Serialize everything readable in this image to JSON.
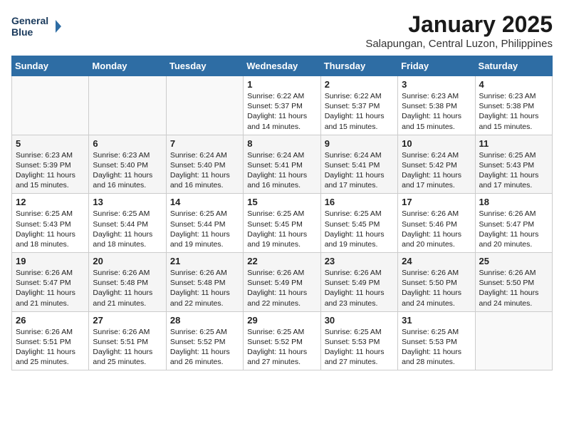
{
  "header": {
    "logo_line1": "General",
    "logo_line2": "Blue",
    "month": "January 2025",
    "location": "Salapungan, Central Luzon, Philippines"
  },
  "weekdays": [
    "Sunday",
    "Monday",
    "Tuesday",
    "Wednesday",
    "Thursday",
    "Friday",
    "Saturday"
  ],
  "weeks": [
    [
      {
        "day": "",
        "sunrise": "",
        "sunset": "",
        "daylight": ""
      },
      {
        "day": "",
        "sunrise": "",
        "sunset": "",
        "daylight": ""
      },
      {
        "day": "",
        "sunrise": "",
        "sunset": "",
        "daylight": ""
      },
      {
        "day": "1",
        "sunrise": "Sunrise: 6:22 AM",
        "sunset": "Sunset: 5:37 PM",
        "daylight": "Daylight: 11 hours and 14 minutes."
      },
      {
        "day": "2",
        "sunrise": "Sunrise: 6:22 AM",
        "sunset": "Sunset: 5:37 PM",
        "daylight": "Daylight: 11 hours and 15 minutes."
      },
      {
        "day": "3",
        "sunrise": "Sunrise: 6:23 AM",
        "sunset": "Sunset: 5:38 PM",
        "daylight": "Daylight: 11 hours and 15 minutes."
      },
      {
        "day": "4",
        "sunrise": "Sunrise: 6:23 AM",
        "sunset": "Sunset: 5:38 PM",
        "daylight": "Daylight: 11 hours and 15 minutes."
      }
    ],
    [
      {
        "day": "5",
        "sunrise": "Sunrise: 6:23 AM",
        "sunset": "Sunset: 5:39 PM",
        "daylight": "Daylight: 11 hours and 15 minutes."
      },
      {
        "day": "6",
        "sunrise": "Sunrise: 6:23 AM",
        "sunset": "Sunset: 5:40 PM",
        "daylight": "Daylight: 11 hours and 16 minutes."
      },
      {
        "day": "7",
        "sunrise": "Sunrise: 6:24 AM",
        "sunset": "Sunset: 5:40 PM",
        "daylight": "Daylight: 11 hours and 16 minutes."
      },
      {
        "day": "8",
        "sunrise": "Sunrise: 6:24 AM",
        "sunset": "Sunset: 5:41 PM",
        "daylight": "Daylight: 11 hours and 16 minutes."
      },
      {
        "day": "9",
        "sunrise": "Sunrise: 6:24 AM",
        "sunset": "Sunset: 5:41 PM",
        "daylight": "Daylight: 11 hours and 17 minutes."
      },
      {
        "day": "10",
        "sunrise": "Sunrise: 6:24 AM",
        "sunset": "Sunset: 5:42 PM",
        "daylight": "Daylight: 11 hours and 17 minutes."
      },
      {
        "day": "11",
        "sunrise": "Sunrise: 6:25 AM",
        "sunset": "Sunset: 5:43 PM",
        "daylight": "Daylight: 11 hours and 17 minutes."
      }
    ],
    [
      {
        "day": "12",
        "sunrise": "Sunrise: 6:25 AM",
        "sunset": "Sunset: 5:43 PM",
        "daylight": "Daylight: 11 hours and 18 minutes."
      },
      {
        "day": "13",
        "sunrise": "Sunrise: 6:25 AM",
        "sunset": "Sunset: 5:44 PM",
        "daylight": "Daylight: 11 hours and 18 minutes."
      },
      {
        "day": "14",
        "sunrise": "Sunrise: 6:25 AM",
        "sunset": "Sunset: 5:44 PM",
        "daylight": "Daylight: 11 hours and 19 minutes."
      },
      {
        "day": "15",
        "sunrise": "Sunrise: 6:25 AM",
        "sunset": "Sunset: 5:45 PM",
        "daylight": "Daylight: 11 hours and 19 minutes."
      },
      {
        "day": "16",
        "sunrise": "Sunrise: 6:25 AM",
        "sunset": "Sunset: 5:45 PM",
        "daylight": "Daylight: 11 hours and 19 minutes."
      },
      {
        "day": "17",
        "sunrise": "Sunrise: 6:26 AM",
        "sunset": "Sunset: 5:46 PM",
        "daylight": "Daylight: 11 hours and 20 minutes."
      },
      {
        "day": "18",
        "sunrise": "Sunrise: 6:26 AM",
        "sunset": "Sunset: 5:47 PM",
        "daylight": "Daylight: 11 hours and 20 minutes."
      }
    ],
    [
      {
        "day": "19",
        "sunrise": "Sunrise: 6:26 AM",
        "sunset": "Sunset: 5:47 PM",
        "daylight": "Daylight: 11 hours and 21 minutes."
      },
      {
        "day": "20",
        "sunrise": "Sunrise: 6:26 AM",
        "sunset": "Sunset: 5:48 PM",
        "daylight": "Daylight: 11 hours and 21 minutes."
      },
      {
        "day": "21",
        "sunrise": "Sunrise: 6:26 AM",
        "sunset": "Sunset: 5:48 PM",
        "daylight": "Daylight: 11 hours and 22 minutes."
      },
      {
        "day": "22",
        "sunrise": "Sunrise: 6:26 AM",
        "sunset": "Sunset: 5:49 PM",
        "daylight": "Daylight: 11 hours and 22 minutes."
      },
      {
        "day": "23",
        "sunrise": "Sunrise: 6:26 AM",
        "sunset": "Sunset: 5:49 PM",
        "daylight": "Daylight: 11 hours and 23 minutes."
      },
      {
        "day": "24",
        "sunrise": "Sunrise: 6:26 AM",
        "sunset": "Sunset: 5:50 PM",
        "daylight": "Daylight: 11 hours and 24 minutes."
      },
      {
        "day": "25",
        "sunrise": "Sunrise: 6:26 AM",
        "sunset": "Sunset: 5:50 PM",
        "daylight": "Daylight: 11 hours and 24 minutes."
      }
    ],
    [
      {
        "day": "26",
        "sunrise": "Sunrise: 6:26 AM",
        "sunset": "Sunset: 5:51 PM",
        "daylight": "Daylight: 11 hours and 25 minutes."
      },
      {
        "day": "27",
        "sunrise": "Sunrise: 6:26 AM",
        "sunset": "Sunset: 5:51 PM",
        "daylight": "Daylight: 11 hours and 25 minutes."
      },
      {
        "day": "28",
        "sunrise": "Sunrise: 6:25 AM",
        "sunset": "Sunset: 5:52 PM",
        "daylight": "Daylight: 11 hours and 26 minutes."
      },
      {
        "day": "29",
        "sunrise": "Sunrise: 6:25 AM",
        "sunset": "Sunset: 5:52 PM",
        "daylight": "Daylight: 11 hours and 27 minutes."
      },
      {
        "day": "30",
        "sunrise": "Sunrise: 6:25 AM",
        "sunset": "Sunset: 5:53 PM",
        "daylight": "Daylight: 11 hours and 27 minutes."
      },
      {
        "day": "31",
        "sunrise": "Sunrise: 6:25 AM",
        "sunset": "Sunset: 5:53 PM",
        "daylight": "Daylight: 11 hours and 28 minutes."
      },
      {
        "day": "",
        "sunrise": "",
        "sunset": "",
        "daylight": ""
      }
    ]
  ]
}
